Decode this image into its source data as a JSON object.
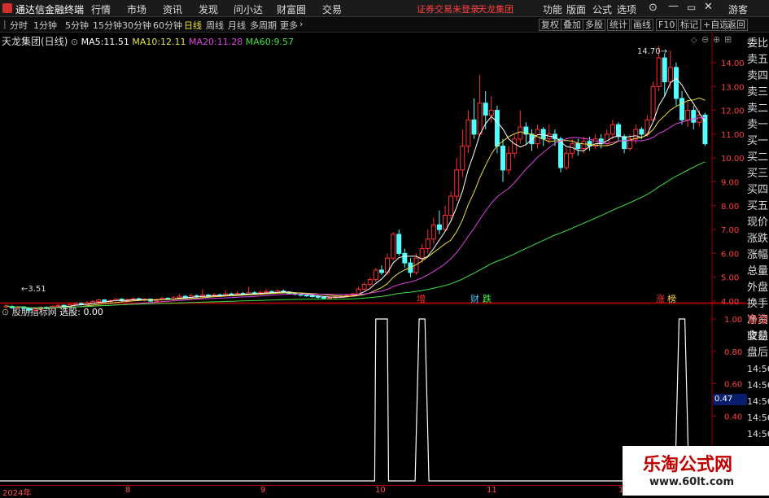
{
  "menubar": {
    "app_title": "通达信金融终端",
    "items": [
      "行情",
      "市场",
      "资讯",
      "发现",
      "问小达",
      "财富圈",
      "交易"
    ],
    "status": "证券交易未登录",
    "stock_name": "天龙集团",
    "right_items": [
      "功能",
      "版面",
      "公式",
      "选项"
    ],
    "user": "游客"
  },
  "toolbar": {
    "periods": [
      "分时",
      "1分钟",
      "5分钟",
      "15分钟",
      "30分钟",
      "60分钟",
      "日线",
      "周线",
      "月线",
      "多周期",
      "更多"
    ],
    "active_period": "日线",
    "right_buttons": [
      "复权",
      "叠加",
      "多股",
      "统计",
      "画线",
      "F10",
      "标记",
      "+自选",
      "返回"
    ]
  },
  "main_chart": {
    "title": "天龙集团(日线)",
    "ma": [
      {
        "label": "MA5:",
        "value": "11.51",
        "color": "#ffffff"
      },
      {
        "label": "MA10:",
        "value": "12.11",
        "color": "#e8e040"
      },
      {
        "label": "MA20:",
        "value": "11.28",
        "color": "#e040e0"
      },
      {
        "label": "MA60:",
        "value": "9.57",
        "color": "#40e040"
      }
    ],
    "high_label": "14.70",
    "low_label": "3.51",
    "price_axis": [
      "14.00",
      "13.00",
      "12.00",
      "11.00",
      "10.00",
      "9.00",
      "8.00",
      "7.00",
      "6.00",
      "5.00",
      "4.00"
    ],
    "markers": [
      {
        "text": "增",
        "color": "#ff3030"
      },
      {
        "text": "财",
        "color": "#40c8ff"
      },
      {
        "text": "跌",
        "color": "#40ff40"
      },
      {
        "text": "涨",
        "color": "#ff3030"
      },
      {
        "text": "榜",
        "color": "#ffd040"
      }
    ]
  },
  "sub_chart": {
    "title": "股朋指标网",
    "select_label": "选股:",
    "select_value": "0.00",
    "axis": [
      "1.00",
      "0.80",
      "0.60",
      "0.40"
    ],
    "current_value": "0.47"
  },
  "side_panel_top": [
    "委比",
    "卖五",
    "卖四",
    "卖三",
    "卖二",
    "卖一",
    "买一",
    "买二",
    "买三",
    "买四",
    "买五",
    "现价",
    "涨跌",
    "涨幅",
    "总量",
    "外盘",
    "换手",
    "净资",
    "收益"
  ],
  "side_panel_bottom": [
    "自动",
    "交易",
    "盘后",
    "14:56",
    "14:56",
    "14:56",
    "14:56",
    "14:56",
    "14:56",
    "14:56",
    "14:56"
  ],
  "date_axis": [
    "2024年",
    "8",
    "9",
    "10",
    "11",
    "1"
  ],
  "watermark": {
    "title": "乐淘公式网",
    "url": "www.60lt.com"
  },
  "chart_data": {
    "type": "candlestick",
    "ylim": [
      3.5,
      14.8
    ],
    "candles": [
      [
        3.75,
        3.8,
        3.85,
        3.7
      ],
      [
        3.78,
        3.72,
        3.82,
        3.68
      ],
      [
        3.72,
        3.76,
        3.8,
        3.65
      ],
      [
        3.76,
        3.7,
        3.78,
        3.62
      ],
      [
        3.7,
        3.62,
        3.72,
        3.51
      ],
      [
        3.62,
        3.68,
        3.7,
        3.58
      ],
      [
        3.68,
        3.74,
        3.78,
        3.64
      ],
      [
        3.74,
        3.7,
        3.78,
        3.66
      ],
      [
        3.7,
        3.78,
        3.82,
        3.68
      ],
      [
        3.78,
        3.82,
        3.86,
        3.74
      ],
      [
        3.82,
        3.78,
        3.86,
        3.74
      ],
      [
        3.78,
        3.85,
        3.9,
        3.76
      ],
      [
        3.85,
        3.9,
        3.95,
        3.82
      ],
      [
        3.9,
        3.86,
        3.95,
        3.82
      ],
      [
        3.86,
        3.92,
        4.0,
        3.84
      ],
      [
        3.92,
        3.98,
        4.05,
        3.9
      ],
      [
        3.98,
        4.05,
        4.1,
        3.94
      ],
      [
        4.05,
        3.98,
        4.08,
        3.95
      ],
      [
        3.98,
        4.02,
        4.06,
        3.94
      ],
      [
        4.02,
        4.08,
        4.12,
        3.98
      ],
      [
        4.08,
        4.02,
        4.12,
        3.98
      ],
      [
        4.02,
        4.06,
        4.1,
        3.96
      ],
      [
        4.06,
        4.1,
        4.15,
        4.02
      ],
      [
        4.1,
        4.04,
        4.14,
        4.0
      ],
      [
        4.04,
        4.08,
        4.12,
        4.0
      ],
      [
        4.08,
        4.0,
        4.1,
        3.96
      ],
      [
        4.0,
        4.06,
        4.1,
        3.96
      ],
      [
        4.06,
        4.12,
        4.18,
        4.02
      ],
      [
        4.12,
        4.08,
        4.16,
        4.04
      ],
      [
        4.08,
        4.14,
        4.2,
        4.04
      ],
      [
        4.14,
        4.2,
        4.3,
        4.1
      ],
      [
        4.2,
        4.15,
        4.25,
        4.1
      ],
      [
        4.15,
        4.22,
        4.3,
        4.12
      ],
      [
        4.22,
        4.18,
        4.28,
        4.14
      ],
      [
        4.18,
        4.25,
        4.5,
        4.15
      ],
      [
        4.25,
        4.2,
        4.3,
        4.16
      ],
      [
        4.2,
        4.26,
        4.35,
        4.18
      ],
      [
        4.26,
        4.22,
        4.32,
        4.18
      ],
      [
        4.22,
        4.3,
        4.45,
        4.2
      ],
      [
        4.3,
        4.26,
        4.36,
        4.22
      ],
      [
        4.26,
        4.32,
        4.4,
        4.22
      ],
      [
        4.32,
        4.28,
        4.38,
        4.24
      ],
      [
        4.28,
        4.35,
        4.6,
        4.26
      ],
      [
        4.35,
        4.3,
        4.42,
        4.26
      ],
      [
        4.3,
        4.36,
        4.45,
        4.28
      ],
      [
        4.36,
        4.4,
        4.5,
        4.32
      ],
      [
        4.4,
        4.35,
        4.45,
        4.3
      ],
      [
        4.35,
        4.42,
        4.5,
        4.32
      ],
      [
        4.42,
        4.38,
        4.48,
        4.34
      ],
      [
        4.38,
        4.32,
        4.42,
        4.28
      ],
      [
        4.32,
        4.28,
        4.36,
        4.24
      ],
      [
        4.28,
        4.25,
        4.32,
        4.2
      ],
      [
        4.25,
        4.22,
        4.3,
        4.18
      ],
      [
        4.22,
        4.2,
        4.26,
        4.14
      ],
      [
        4.2,
        4.16,
        4.24,
        4.1
      ],
      [
        4.16,
        4.12,
        4.2,
        4.08
      ],
      [
        4.12,
        4.15,
        4.2,
        4.08
      ],
      [
        4.15,
        4.18,
        4.24,
        4.1
      ],
      [
        4.18,
        4.2,
        4.25,
        4.14
      ],
      [
        4.2,
        4.24,
        4.3,
        4.16
      ],
      [
        4.24,
        4.3,
        4.35,
        4.2
      ],
      [
        4.3,
        4.5,
        4.6,
        4.28
      ],
      [
        4.5,
        4.7,
        4.8,
        4.45
      ],
      [
        4.7,
        4.9,
        5.0,
        4.6
      ],
      [
        4.9,
        5.3,
        5.4,
        4.8
      ],
      [
        5.3,
        5.2,
        5.5,
        5.1
      ],
      [
        5.2,
        5.8,
        6.0,
        5.1
      ],
      [
        5.8,
        6.8,
        6.9,
        5.7
      ],
      [
        6.8,
        6.0,
        7.0,
        5.9
      ],
      [
        6.0,
        5.6,
        6.2,
        5.4
      ],
      [
        5.6,
        5.2,
        5.8,
        5.0
      ],
      [
        5.2,
        5.8,
        6.0,
        5.1
      ],
      [
        5.8,
        6.2,
        6.4,
        5.6
      ],
      [
        6.2,
        6.6,
        7.0,
        6.0
      ],
      [
        6.6,
        7.2,
        7.5,
        6.4
      ],
      [
        7.2,
        7.0,
        7.8,
        6.8
      ],
      [
        7.0,
        7.6,
        8.0,
        6.9
      ],
      [
        7.6,
        8.4,
        8.6,
        7.4
      ],
      [
        8.4,
        9.5,
        10.0,
        8.2
      ],
      [
        9.5,
        10.5,
        11.2,
        9.2
      ],
      [
        10.5,
        11.6,
        12.0,
        10.2
      ],
      [
        11.6,
        11.0,
        12.5,
        10.8
      ],
      [
        11.0,
        12.3,
        13.5,
        10.9
      ],
      [
        12.3,
        11.8,
        12.8,
        11.2
      ],
      [
        11.8,
        12.0,
        12.6,
        11.5
      ],
      [
        12.0,
        10.5,
        12.2,
        10.2
      ],
      [
        10.5,
        9.5,
        10.8,
        9.0
      ],
      [
        9.5,
        10.2,
        10.5,
        9.3
      ],
      [
        10.2,
        10.8,
        11.0,
        10.0
      ],
      [
        10.8,
        11.3,
        12.0,
        10.6
      ],
      [
        11.3,
        11.0,
        11.5,
        10.6
      ],
      [
        11.0,
        10.6,
        11.2,
        10.3
      ],
      [
        10.6,
        11.2,
        11.4,
        10.4
      ],
      [
        11.2,
        10.8,
        11.3,
        10.5
      ],
      [
        10.8,
        11.0,
        11.4,
        10.6
      ],
      [
        11.0,
        10.8,
        11.2,
        10.5
      ],
      [
        10.8,
        9.6,
        10.9,
        9.4
      ],
      [
        9.6,
        10.2,
        10.4,
        9.5
      ],
      [
        10.2,
        10.6,
        10.8,
        10.0
      ],
      [
        10.6,
        10.4,
        10.8,
        10.1
      ],
      [
        10.4,
        10.7,
        10.9,
        10.2
      ],
      [
        10.7,
        10.5,
        10.9,
        10.3
      ],
      [
        10.5,
        10.8,
        11.0,
        10.4
      ],
      [
        10.8,
        10.6,
        11.0,
        10.4
      ],
      [
        10.6,
        11.0,
        11.2,
        10.5
      ],
      [
        11.0,
        11.4,
        11.6,
        10.8
      ],
      [
        11.4,
        10.9,
        11.5,
        10.7
      ],
      [
        10.9,
        10.4,
        11.0,
        10.2
      ],
      [
        10.4,
        10.8,
        11.0,
        10.3
      ],
      [
        10.8,
        11.2,
        11.4,
        10.6
      ],
      [
        11.2,
        11.0,
        11.3,
        10.8
      ],
      [
        11.0,
        11.6,
        11.8,
        10.9
      ],
      [
        11.6,
        13.0,
        13.2,
        11.5
      ],
      [
        13.0,
        14.2,
        14.7,
        12.8
      ],
      [
        14.2,
        13.2,
        14.4,
        12.6
      ],
      [
        13.2,
        13.8,
        14.5,
        12.9
      ],
      [
        13.8,
        12.5,
        14.0,
        12.2
      ],
      [
        12.5,
        11.6,
        12.8,
        11.4
      ],
      [
        11.6,
        12.0,
        12.4,
        11.3
      ],
      [
        12.0,
        11.5,
        12.2,
        11.2
      ],
      [
        11.5,
        11.8,
        12.0,
        11.3
      ],
      [
        11.8,
        10.6,
        11.9,
        10.5
      ]
    ],
    "series": [
      {
        "name": "MA5"
      },
      {
        "name": "MA10"
      },
      {
        "name": "MA20"
      },
      {
        "name": "MA60"
      }
    ],
    "indicator": {
      "name": "选股",
      "ylim": [
        0,
        1
      ],
      "signals": [
        65,
        72,
        117
      ]
    }
  }
}
